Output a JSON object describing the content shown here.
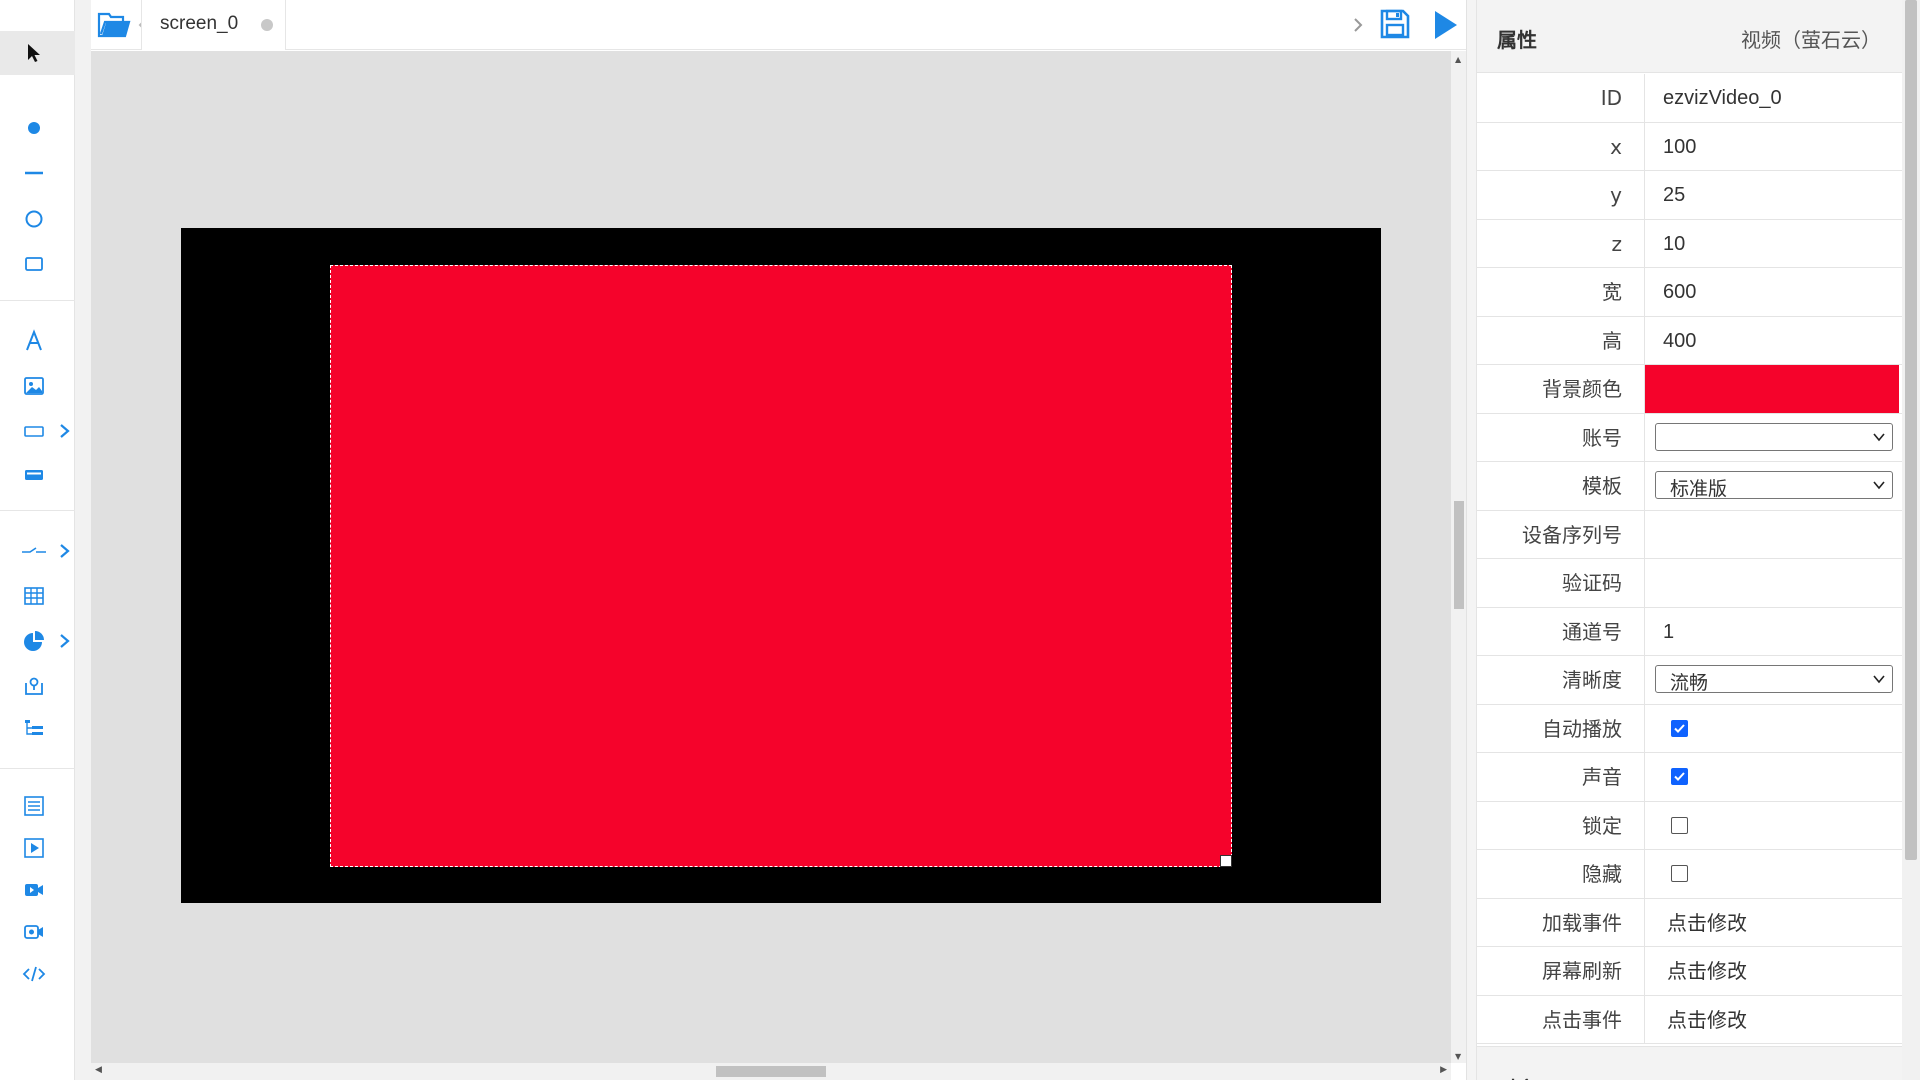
{
  "tab": {
    "label": "screen_0"
  },
  "panel": {
    "title": "属性",
    "widget_type": "视频（萤石云）",
    "rows": {
      "id": {
        "label": "ID",
        "value": "ezvizVideo_0"
      },
      "x": {
        "label": "x",
        "value": "100"
      },
      "y": {
        "label": "y",
        "value": "25"
      },
      "z": {
        "label": "z",
        "value": "10"
      },
      "width": {
        "label": "宽",
        "value": "600"
      },
      "height": {
        "label": "高",
        "value": "400"
      },
      "bg": {
        "label": "背景颜色",
        "color": "#f5032b"
      },
      "account": {
        "label": "账号",
        "value": ""
      },
      "template": {
        "label": "模板",
        "value": "标准版"
      },
      "serial": {
        "label": "设备序列号",
        "value": ""
      },
      "code": {
        "label": "验证码",
        "value": ""
      },
      "channel": {
        "label": "通道号",
        "value": "1"
      },
      "quality": {
        "label": "清晰度",
        "value": "流畅"
      },
      "autoplay": {
        "label": "自动播放",
        "checked": true
      },
      "sound": {
        "label": "声音",
        "checked": true
      },
      "lock": {
        "label": "锁定",
        "checked": false
      },
      "hide": {
        "label": "隐藏",
        "checked": false
      },
      "onload": {
        "label": "加载事件",
        "value": "点击修改"
      },
      "refresh": {
        "label": "屏幕刷新",
        "value": "点击修改"
      },
      "onclick": {
        "label": "点击事件",
        "value": "点击修改"
      }
    },
    "next_section": "对齐"
  },
  "canvas": {
    "screen_color": "#000000",
    "widget_color": "#f5032b",
    "workspace_color": "#e0e0e0"
  },
  "icons": {
    "toolbar": [
      "pointer-icon",
      "dot-icon",
      "line-icon",
      "circle-icon",
      "rect-icon",
      "text-icon",
      "image-icon",
      "input-icon",
      "button-icon",
      "switch-icon",
      "table-icon",
      "pie-chart-icon",
      "map-icon",
      "tree-icon",
      "list-icon",
      "video-icon",
      "live-video-icon",
      "camera-icon",
      "code-icon"
    ],
    "topbar": [
      "folder-open-icon",
      "save-icon",
      "play-icon"
    ]
  }
}
